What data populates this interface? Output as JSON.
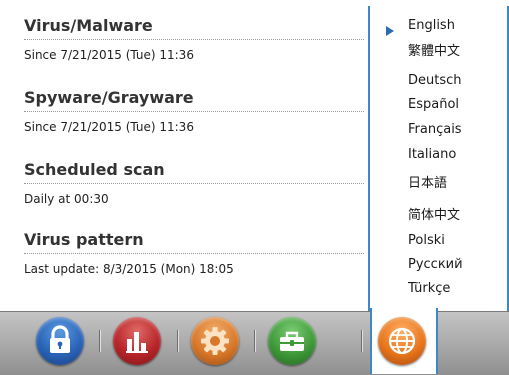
{
  "status": {
    "virus_malware": {
      "title": "Virus/Malware",
      "detail": "Since 7/21/2015 (Tue) 11:36"
    },
    "spyware": {
      "title": "Spyware/Grayware",
      "detail": "Since 7/21/2015 (Tue) 11:36"
    },
    "scheduled_scan": {
      "title": "Scheduled scan",
      "detail": "Daily at 00:30"
    },
    "virus_pattern": {
      "title": "Virus pattern",
      "detail": "Last update: 8/3/2015 (Mon) 18:05"
    }
  },
  "language_menu": {
    "selected": "English",
    "items": [
      "English",
      "繁體中文",
      "Deutsch",
      "Español",
      "Français",
      "Italiano",
      "日本語",
      "简体中文",
      "Polski",
      "Русский",
      "Türkçe"
    ]
  },
  "taskbar": {
    "buttons": [
      {
        "icon": "lock-icon",
        "color": "#2a64b8"
      },
      {
        "icon": "bar-chart-icon",
        "color": "#b8262a"
      },
      {
        "icon": "gear-icon",
        "color": "#d9782a"
      },
      {
        "icon": "toolbox-icon",
        "color": "#3f9a3a"
      },
      {
        "icon": "globe-icon",
        "color": "#e8761c",
        "active": true
      }
    ]
  }
}
